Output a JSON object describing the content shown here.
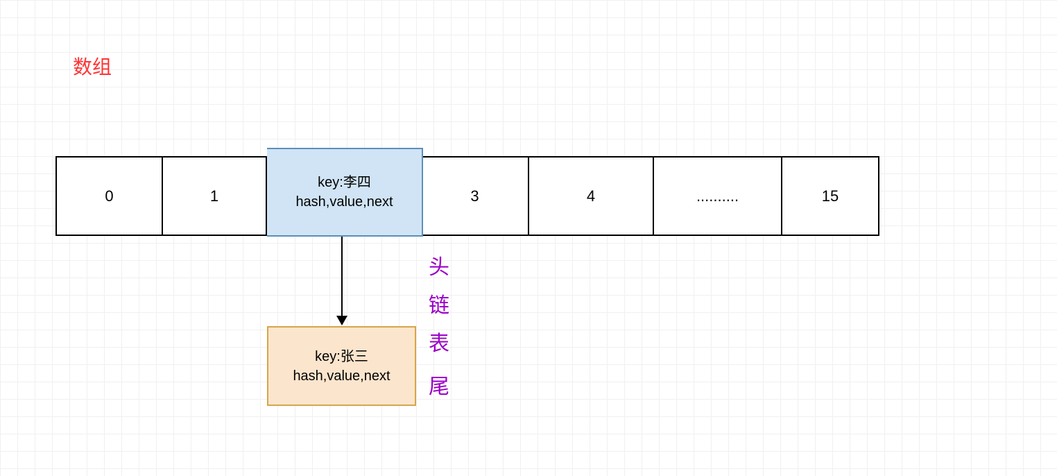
{
  "title": "数组",
  "cells": {
    "c0": "0",
    "c1": "1",
    "c2_line1": "key:李四",
    "c2_line2": "hash,value,next",
    "c3": "3",
    "c4": "4",
    "c5": "..........",
    "c6": "15"
  },
  "node": {
    "line1": "key:张三",
    "line2": "hash,value,next"
  },
  "vertical_label": {
    "v0": "头",
    "v1": "链",
    "v2": "表",
    "v3": "尾"
  }
}
